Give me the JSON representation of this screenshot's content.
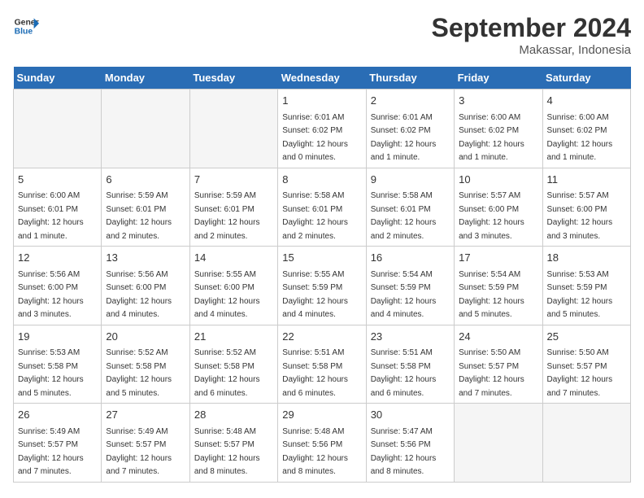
{
  "logo": {
    "line1": "General",
    "line2": "Blue"
  },
  "title": "September 2024",
  "location": "Makassar, Indonesia",
  "weekdays": [
    "Sunday",
    "Monday",
    "Tuesday",
    "Wednesday",
    "Thursday",
    "Friday",
    "Saturday"
  ],
  "days": [
    {
      "day": "",
      "info": ""
    },
    {
      "day": "",
      "info": ""
    },
    {
      "day": "",
      "info": ""
    },
    {
      "day": "1",
      "info": "Sunrise: 6:01 AM\nSunset: 6:02 PM\nDaylight: 12 hours\nand 0 minutes."
    },
    {
      "day": "2",
      "info": "Sunrise: 6:01 AM\nSunset: 6:02 PM\nDaylight: 12 hours\nand 1 minute."
    },
    {
      "day": "3",
      "info": "Sunrise: 6:00 AM\nSunset: 6:02 PM\nDaylight: 12 hours\nand 1 minute."
    },
    {
      "day": "4",
      "info": "Sunrise: 6:00 AM\nSunset: 6:02 PM\nDaylight: 12 hours\nand 1 minute."
    },
    {
      "day": "5",
      "info": "Sunrise: 6:00 AM\nSunset: 6:01 PM\nDaylight: 12 hours\nand 1 minute."
    },
    {
      "day": "6",
      "info": "Sunrise: 5:59 AM\nSunset: 6:01 PM\nDaylight: 12 hours\nand 2 minutes."
    },
    {
      "day": "7",
      "info": "Sunrise: 5:59 AM\nSunset: 6:01 PM\nDaylight: 12 hours\nand 2 minutes."
    },
    {
      "day": "8",
      "info": "Sunrise: 5:58 AM\nSunset: 6:01 PM\nDaylight: 12 hours\nand 2 minutes."
    },
    {
      "day": "9",
      "info": "Sunrise: 5:58 AM\nSunset: 6:01 PM\nDaylight: 12 hours\nand 2 minutes."
    },
    {
      "day": "10",
      "info": "Sunrise: 5:57 AM\nSunset: 6:00 PM\nDaylight: 12 hours\nand 3 minutes."
    },
    {
      "day": "11",
      "info": "Sunrise: 5:57 AM\nSunset: 6:00 PM\nDaylight: 12 hours\nand 3 minutes."
    },
    {
      "day": "12",
      "info": "Sunrise: 5:56 AM\nSunset: 6:00 PM\nDaylight: 12 hours\nand 3 minutes."
    },
    {
      "day": "13",
      "info": "Sunrise: 5:56 AM\nSunset: 6:00 PM\nDaylight: 12 hours\nand 4 minutes."
    },
    {
      "day": "14",
      "info": "Sunrise: 5:55 AM\nSunset: 6:00 PM\nDaylight: 12 hours\nand 4 minutes."
    },
    {
      "day": "15",
      "info": "Sunrise: 5:55 AM\nSunset: 5:59 PM\nDaylight: 12 hours\nand 4 minutes."
    },
    {
      "day": "16",
      "info": "Sunrise: 5:54 AM\nSunset: 5:59 PM\nDaylight: 12 hours\nand 4 minutes."
    },
    {
      "day": "17",
      "info": "Sunrise: 5:54 AM\nSunset: 5:59 PM\nDaylight: 12 hours\nand 5 minutes."
    },
    {
      "day": "18",
      "info": "Sunrise: 5:53 AM\nSunset: 5:59 PM\nDaylight: 12 hours\nand 5 minutes."
    },
    {
      "day": "19",
      "info": "Sunrise: 5:53 AM\nSunset: 5:58 PM\nDaylight: 12 hours\nand 5 minutes."
    },
    {
      "day": "20",
      "info": "Sunrise: 5:52 AM\nSunset: 5:58 PM\nDaylight: 12 hours\nand 5 minutes."
    },
    {
      "day": "21",
      "info": "Sunrise: 5:52 AM\nSunset: 5:58 PM\nDaylight: 12 hours\nand 6 minutes."
    },
    {
      "day": "22",
      "info": "Sunrise: 5:51 AM\nSunset: 5:58 PM\nDaylight: 12 hours\nand 6 minutes."
    },
    {
      "day": "23",
      "info": "Sunrise: 5:51 AM\nSunset: 5:58 PM\nDaylight: 12 hours\nand 6 minutes."
    },
    {
      "day": "24",
      "info": "Sunrise: 5:50 AM\nSunset: 5:57 PM\nDaylight: 12 hours\nand 7 minutes."
    },
    {
      "day": "25",
      "info": "Sunrise: 5:50 AM\nSunset: 5:57 PM\nDaylight: 12 hours\nand 7 minutes."
    },
    {
      "day": "26",
      "info": "Sunrise: 5:49 AM\nSunset: 5:57 PM\nDaylight: 12 hours\nand 7 minutes."
    },
    {
      "day": "27",
      "info": "Sunrise: 5:49 AM\nSunset: 5:57 PM\nDaylight: 12 hours\nand 7 minutes."
    },
    {
      "day": "28",
      "info": "Sunrise: 5:48 AM\nSunset: 5:57 PM\nDaylight: 12 hours\nand 8 minutes."
    },
    {
      "day": "29",
      "info": "Sunrise: 5:48 AM\nSunset: 5:56 PM\nDaylight: 12 hours\nand 8 minutes."
    },
    {
      "day": "30",
      "info": "Sunrise: 5:47 AM\nSunset: 5:56 PM\nDaylight: 12 hours\nand 8 minutes."
    },
    {
      "day": "",
      "info": ""
    },
    {
      "day": "",
      "info": ""
    },
    {
      "day": "",
      "info": ""
    }
  ]
}
